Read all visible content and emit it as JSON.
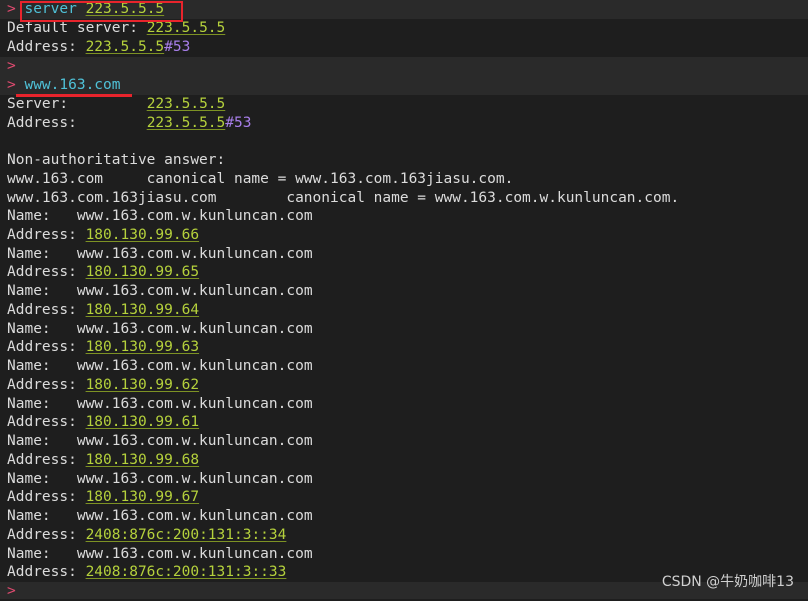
{
  "prompt_symbol": ">",
  "block1": {
    "cmd_word": "server",
    "cmd_arg": "223.5.5.5",
    "default_label": "Default server: ",
    "default_value": "223.5.5.5",
    "addr_label": "Address: ",
    "addr_ip": "223.5.5.5",
    "addr_port": "#53"
  },
  "block2": {
    "cmd": "www.163.com",
    "server_label": "Server:         ",
    "server_value": "223.5.5.5",
    "addr_label": "Address:        ",
    "addr_ip": "223.5.5.5",
    "addr_port": "#53",
    "nonauth": "Non-authoritative answer:",
    "cname1": "www.163.com     canonical name = www.163.com.163jiasu.com.",
    "cname2": "www.163.com.163jiasu.com        canonical name = www.163.com.w.kunluncan.com.",
    "name_label": "Name:   ",
    "addr_label2": "Address: ",
    "records": [
      {
        "name": "www.163.com.w.kunluncan.com",
        "address": "180.130.99.66"
      },
      {
        "name": "www.163.com.w.kunluncan.com",
        "address": "180.130.99.65"
      },
      {
        "name": "www.163.com.w.kunluncan.com",
        "address": "180.130.99.64"
      },
      {
        "name": "www.163.com.w.kunluncan.com",
        "address": "180.130.99.63"
      },
      {
        "name": "www.163.com.w.kunluncan.com",
        "address": "180.130.99.62"
      },
      {
        "name": "www.163.com.w.kunluncan.com",
        "address": "180.130.99.61"
      },
      {
        "name": "www.163.com.w.kunluncan.com",
        "address": "180.130.99.68"
      },
      {
        "name": "www.163.com.w.kunluncan.com",
        "address": "180.130.99.67"
      },
      {
        "name": "www.163.com.w.kunluncan.com",
        "address": "2408:876c:200:131:3::34"
      },
      {
        "name": "www.163.com.w.kunluncan.com",
        "address": "2408:876c:200:131:3::33"
      }
    ]
  },
  "watermark": "CSDN @牛奶咖啡13"
}
